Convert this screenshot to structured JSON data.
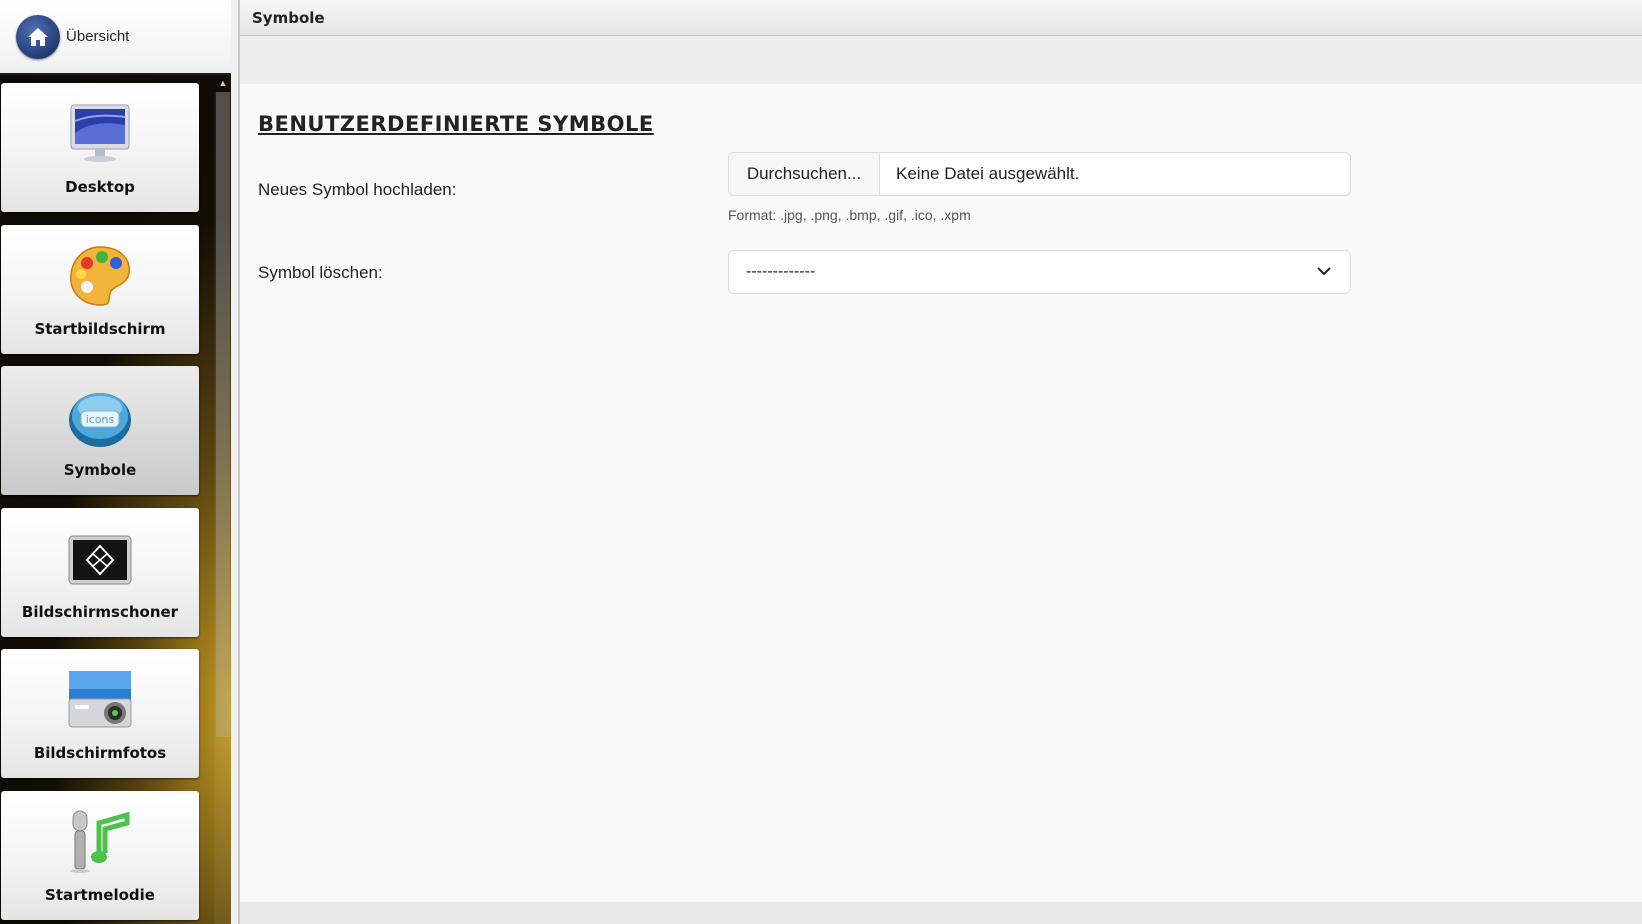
{
  "home": {
    "label": "Übersicht"
  },
  "sidebar": {
    "items": [
      {
        "label": "Desktop",
        "icon": "desktop-monitor-icon",
        "active": false
      },
      {
        "label": "Startbildschirm",
        "icon": "paint-palette-icon",
        "active": false
      },
      {
        "label": "Symbole",
        "icon": "icons-badge-icon",
        "active": true
      },
      {
        "label": "Bildschirmschoner",
        "icon": "screensaver-icon",
        "active": false
      },
      {
        "label": "Bildschirmfotos",
        "icon": "camera-icon",
        "active": false
      },
      {
        "label": "Startmelodie",
        "icon": "microphone-music-note-icon",
        "active": false
      }
    ]
  },
  "titlebar": {
    "title": "Symbole"
  },
  "section": {
    "heading": "BENUTZERDEFINIERTE SYMBOLE"
  },
  "upload": {
    "label": "Neues Symbol hochladen:",
    "browse_button": "Durchsuchen...",
    "file_status": "Keine Datei ausgewählt.",
    "format_hint": "Format: .jpg, .png, .bmp, .gif, .ico, .xpm"
  },
  "delete": {
    "label": "Symbol löschen:",
    "selected": "-------------"
  },
  "colors": {
    "heading": "#222222",
    "sidebar_bg": "#0d0b06",
    "accent_gold": "#c49a1f"
  }
}
